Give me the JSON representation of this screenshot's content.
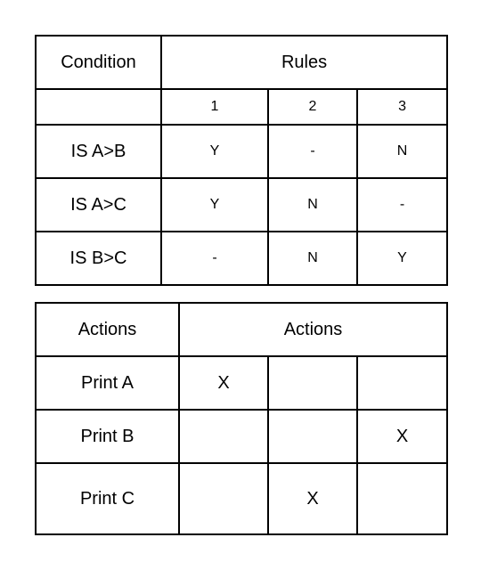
{
  "condition_table": {
    "header": {
      "condition_label": "Condition",
      "rules_label": "Rules"
    },
    "rule_numbers": [
      "1",
      "2",
      "3"
    ],
    "rows": [
      {
        "condition": "IS A>B",
        "values": [
          "Y",
          "-",
          "N"
        ]
      },
      {
        "condition": "IS A>C",
        "values": [
          "Y",
          "N",
          "-"
        ]
      },
      {
        "condition": "IS B>C",
        "values": [
          "-",
          "N",
          "Y"
        ]
      }
    ]
  },
  "action_table": {
    "header": {
      "actions_label": "Actions",
      "actions_span_label": "Actions"
    },
    "rows": [
      {
        "action": "Print A",
        "marks": [
          "X",
          "",
          ""
        ]
      },
      {
        "action": "Print B",
        "marks": [
          "",
          "",
          "X"
        ]
      },
      {
        "action": "Print C",
        "marks": [
          "",
          "X",
          ""
        ]
      }
    ]
  }
}
